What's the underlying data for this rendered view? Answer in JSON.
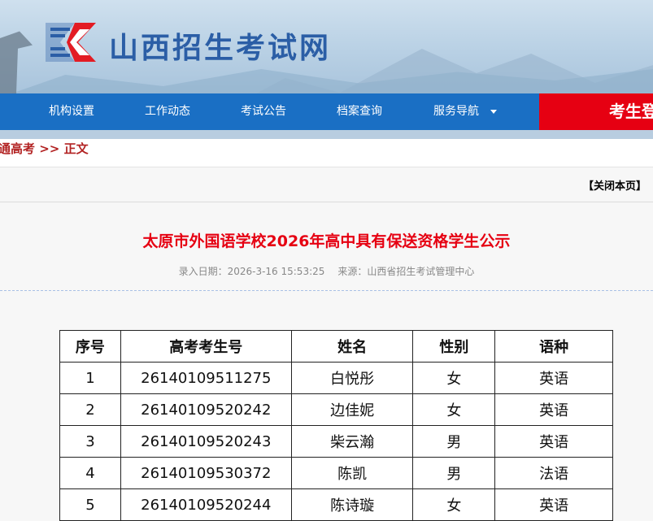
{
  "header": {
    "site_title": "山西招生考试网"
  },
  "nav": {
    "items": [
      "机构设置",
      "工作动态",
      "考试公告",
      "档案查询",
      "服务导航"
    ],
    "login_label": "考生登"
  },
  "breadcrumb": {
    "text": "通高考 >> 正文"
  },
  "toolbar": {
    "close_label": "【关闭本页】"
  },
  "article": {
    "title": "太原市外国语学校2026年高中具有保送资格学生公示",
    "entry_date": "录入日期：2026-3-16 15:53:25",
    "source": "来源：山西省招生考试管理中心"
  },
  "table": {
    "headers": [
      "序号",
      "高考考生号",
      "姓名",
      "性别",
      "语种"
    ],
    "rows": [
      [
        "1",
        "26140109511275",
        "白悦彤",
        "女",
        "英语"
      ],
      [
        "2",
        "26140109520242",
        "边佳妮",
        "女",
        "英语"
      ],
      [
        "3",
        "26140109520243",
        "柴云瀚",
        "男",
        "英语"
      ],
      [
        "4",
        "26140109530372",
        "陈凯",
        "男",
        "法语"
      ],
      [
        "5",
        "26140109520244",
        "陈诗璇",
        "女",
        "英语"
      ]
    ]
  },
  "colors": {
    "nav_blue": "#1a6fc4",
    "accent_red": "#e60012",
    "breadcrumb_red": "#b22222",
    "title_blue": "#2b5ea6"
  },
  "icons": {
    "logo": "exam-logo-icon",
    "nav_caret": "chevron-down-icon"
  }
}
